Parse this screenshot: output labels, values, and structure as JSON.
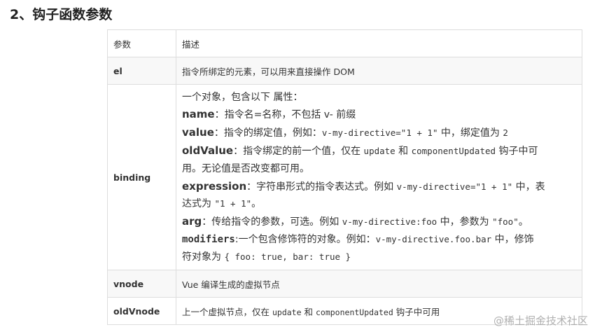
{
  "heading": "2、钩子函数参数",
  "table": {
    "header": {
      "param": "参数",
      "desc": "描述"
    },
    "el": {
      "name": "el",
      "desc": "指令所绑定的元素，可以用来直接操作 DOM"
    },
    "binding": {
      "name": "binding",
      "intro": "一个对象，包含以下 属性：",
      "name_key": "name",
      "name_text": "：指令名=名称，不包括 v- 前缀",
      "value_key": "value",
      "value_text1": "：指令的绑定值，例如：",
      "value_code": "v-my-directive=\"1 + 1\"",
      "value_text2": " 中，绑定值为 ",
      "value_code2": "2",
      "oldValue_key": "oldValue",
      "oldValue_text1": "：指令绑定的前一个值，仅在 ",
      "oldValue_code1": "update",
      "oldValue_text2": " 和 ",
      "oldValue_code2": "componentUpdated",
      "oldValue_text3": " 钩子中可",
      "oldValue_text4": "用。无论值是否改变都可用。",
      "expression_key": "expression",
      "expression_text1": "：字符串形式的指令表达式。例如 ",
      "expression_code1": "v-my-directive=\"1 + 1\"",
      "expression_text2": " 中，表",
      "expression_text3": "达式为 ",
      "expression_code2": "\"1 + 1\"",
      "expression_text4": "。",
      "arg_key": "arg",
      "arg_text1": "：传给指令的参数，可选。例如 ",
      "arg_code1": "v-my-directive:foo",
      "arg_text2": " 中，参数为 ",
      "arg_code2": "\"foo\"",
      "arg_text3": "。",
      "modifiers_key": "modifiers",
      "modifiers_text1": ":一个包含修饰符的对象。例如：",
      "modifiers_code1": "v-my-directive.foo.bar",
      "modifiers_text2": " 中，修饰",
      "modifiers_text3": "符对象为 ",
      "modifiers_code2": "{ foo: true, bar: true }"
    },
    "vnode": {
      "name": "vnode",
      "desc": "Vue 编译生成的虚拟节点"
    },
    "oldVnode": {
      "name": "oldVnode",
      "desc1": "上一个虚拟节点，仅在 ",
      "code1": "update",
      "desc2": " 和 ",
      "code2": "componentUpdated",
      "desc3": " 钩子中可用"
    }
  },
  "watermark": "@稀土掘金技术社区"
}
